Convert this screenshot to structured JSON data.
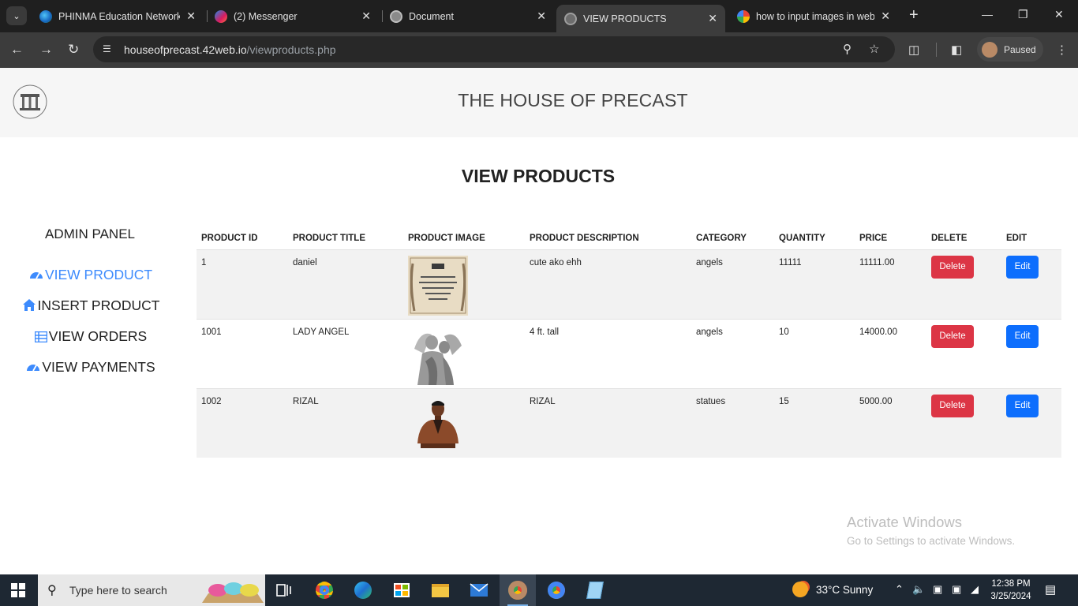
{
  "browser": {
    "tabs": [
      {
        "title": "PHINMA Education Network",
        "icon": "phinma-globe-icon",
        "active": false
      },
      {
        "title": "(2) Messenger",
        "icon": "messenger-icon",
        "active": false
      },
      {
        "title": "Document",
        "icon": "globe-icon",
        "active": false
      },
      {
        "title": "VIEW PRODUCTS",
        "icon": "globe-icon",
        "active": true
      },
      {
        "title": "how to input images in web",
        "icon": "google-icon",
        "active": false
      }
    ],
    "url_domain": "houseofprecast.42web.io",
    "url_path": "/viewproducts.php",
    "profile_label": "Paused"
  },
  "site": {
    "title": "THE HOUSE OF PRECAST",
    "page_heading": "VIEW PRODUCTS"
  },
  "sidebar": {
    "title": "ADMIN PANEL",
    "items": [
      {
        "label": "VIEW PRODUCT",
        "icon": "dashboard-gauge-icon",
        "active": true
      },
      {
        "label": "INSERT PRODUCT",
        "icon": "home-icon",
        "active": false
      },
      {
        "label": "VIEW ORDERS",
        "icon": "table-list-icon",
        "active": false
      },
      {
        "label": "VIEW PAYMENTS",
        "icon": "dashboard-gauge-icon",
        "active": false
      }
    ]
  },
  "table": {
    "headers": [
      "PRODUCT ID",
      "PRODUCT TITLE",
      "PRODUCT IMAGE",
      "PRODUCT DESCRIPTION",
      "CATEGORY",
      "QUANTITY",
      "PRICE",
      "DELETE",
      "EDIT"
    ],
    "rows": [
      {
        "id": "1",
        "title": "daniel",
        "image": "certificate-image",
        "description": "cute ako ehh",
        "category": "angels",
        "quantity": "11111",
        "price": "11111.00",
        "delete_label": "Delete",
        "edit_label": "Edit"
      },
      {
        "id": "1001",
        "title": "LADY ANGEL",
        "image": "angel-statue-image",
        "description": "4 ft. tall",
        "category": "angels",
        "quantity": "10",
        "price": "14000.00",
        "delete_label": "Delete",
        "edit_label": "Edit"
      },
      {
        "id": "1002",
        "title": "RIZAL",
        "image": "rizal-bust-image",
        "description": "RIZAL",
        "category": "statues",
        "quantity": "15",
        "price": "5000.00",
        "delete_label": "Delete",
        "edit_label": "Edit"
      }
    ]
  },
  "watermark": {
    "line1": "Activate Windows",
    "line2": "Go to Settings to activate Windows."
  },
  "taskbar": {
    "search_placeholder": "Type here to search",
    "weather": "33°C  Sunny",
    "time": "12:38 PM",
    "date": "3/25/2024"
  },
  "colors": {
    "accent": "#3d8bfd",
    "delete": "#dc3545",
    "edit": "#0d6efd",
    "header_bg": "#f6f6f6"
  }
}
